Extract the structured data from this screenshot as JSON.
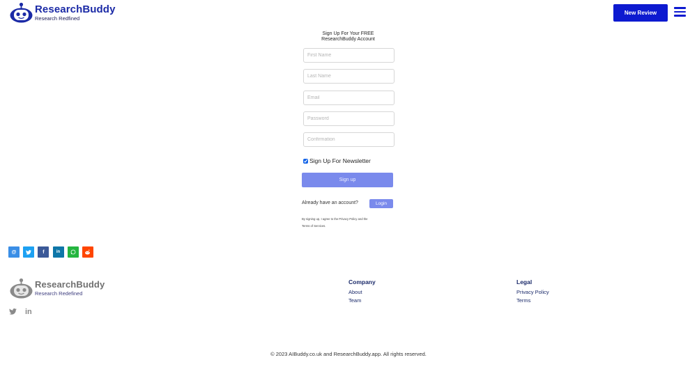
{
  "header": {
    "brand_title": "ResearchBuddy",
    "brand_subtitle": "Research Redfined",
    "new_review_label": "New Review",
    "accent_color": "#0d1ad0"
  },
  "form": {
    "title_line1": "Sign Up For Your FREE",
    "title_line2": "ResearchBuddy Account",
    "first_name_placeholder": "First Name",
    "last_name_placeholder": "Last Name",
    "email_placeholder": "Email",
    "password_placeholder": "Password",
    "confirmation_placeholder": "Confirmation",
    "newsletter_label": "Sign Up For Newsletter",
    "newsletter_checked": true,
    "signup_label": "Sign up",
    "already_text": "Already have an account?",
    "login_label": "Login",
    "terms_line1": "By signing up, I agree to the Privacy Policy and the",
    "terms_line2": "Terms of Services."
  },
  "share": [
    {
      "name": "email",
      "icon": "at-icon",
      "glyph": "@",
      "color": "#3a8ee6"
    },
    {
      "name": "twitter",
      "icon": "twitter-icon",
      "glyph": "t",
      "color": "#1da1f2"
    },
    {
      "name": "facebook",
      "icon": "facebook-icon",
      "glyph": "f",
      "color": "#3b5998"
    },
    {
      "name": "linkedin",
      "icon": "linkedin-icon",
      "glyph": "in",
      "color": "#0e76a8"
    },
    {
      "name": "whatsapp",
      "icon": "whatsapp-icon",
      "glyph": "w",
      "color": "#25b540"
    },
    {
      "name": "reddit",
      "icon": "reddit-icon",
      "glyph": "r",
      "color": "#ff4500"
    }
  ],
  "footer": {
    "brand_title": "ResearchBuddy",
    "brand_subtitle": "Research Redefined",
    "company_heading": "Company",
    "company_links": [
      "About",
      "Team"
    ],
    "legal_heading": "Legal",
    "legal_links": [
      "Privacy Policy",
      "Terms"
    ],
    "copyright": "© 2023 AIBuddy.co.uk and ResearchBuddy.app. All rights reserved."
  }
}
